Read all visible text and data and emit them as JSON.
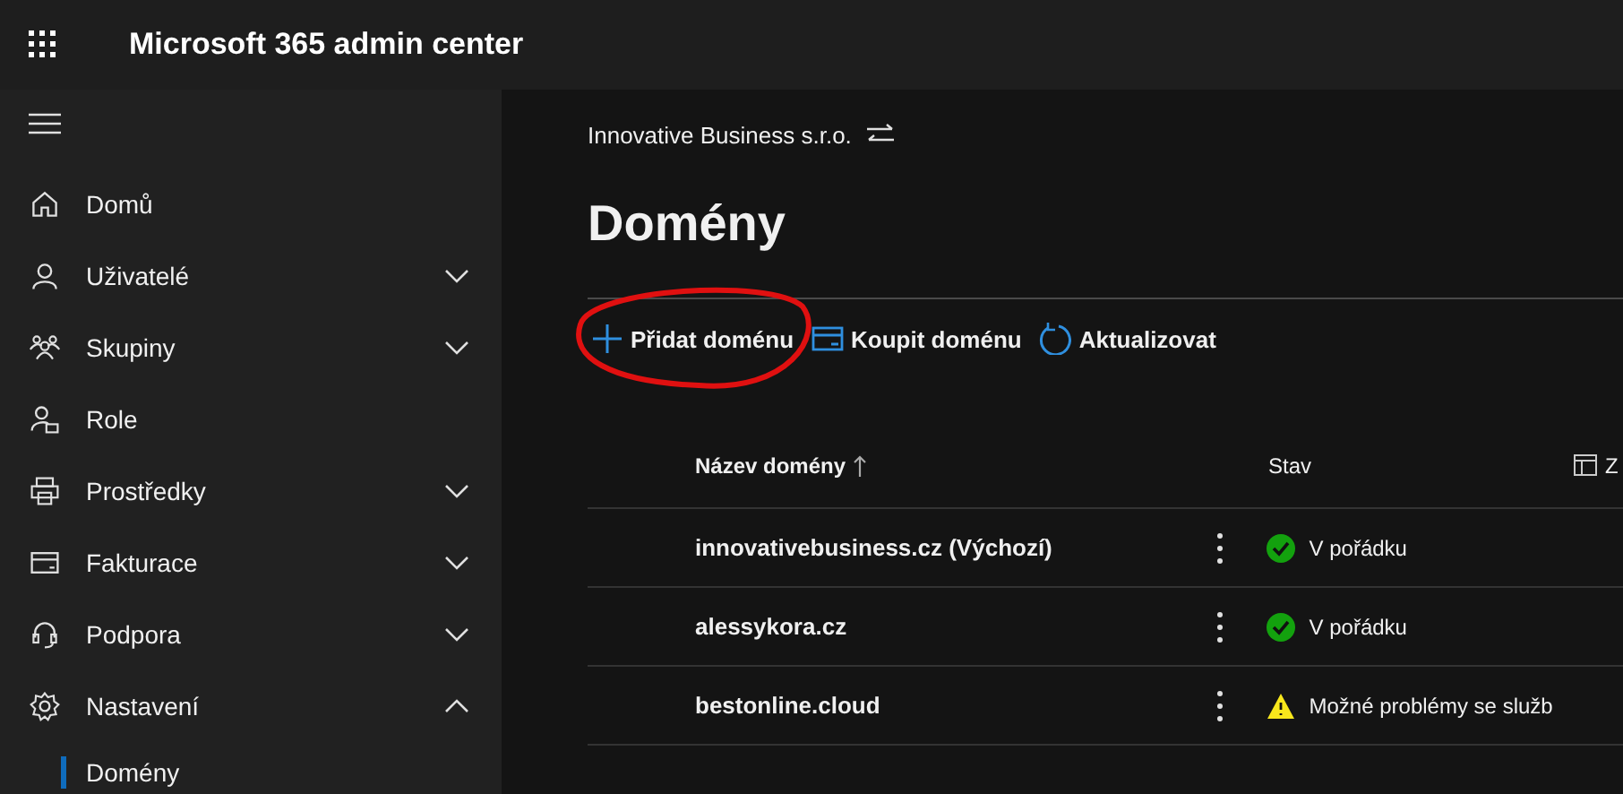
{
  "app": {
    "title": "Microsoft 365 admin center"
  },
  "sidebar": {
    "items": [
      {
        "label": "Domů"
      },
      {
        "label": "Uživatelé",
        "expanded": false
      },
      {
        "label": "Skupiny",
        "expanded": false
      },
      {
        "label": "Role"
      },
      {
        "label": "Prostředky",
        "expanded": false
      },
      {
        "label": "Fakturace",
        "expanded": false
      },
      {
        "label": "Podpora",
        "expanded": false
      },
      {
        "label": "Nastavení",
        "expanded": true,
        "children": [
          {
            "label": "Domény",
            "selected": true
          }
        ]
      }
    ]
  },
  "page": {
    "organization": "Innovative Business s.r.o.",
    "title": "Domény"
  },
  "toolbar": [
    {
      "label": "Přidat doménu",
      "circled": true
    },
    {
      "label": "Koupit doménu",
      "circled": false
    },
    {
      "label": "Aktualizovat",
      "circled": false
    }
  ],
  "table": {
    "columns": [
      {
        "label": "Název domény",
        "sorted": true
      },
      {
        "label": "Stav",
        "sorted": false
      },
      {
        "label": "Z",
        "sorted": false
      }
    ],
    "rows": [
      {
        "name": "innovativebusiness.cz (Výchozí)",
        "kind": "ok",
        "status": "V pořádku"
      },
      {
        "name": "alessykora.cz",
        "kind": "ok",
        "status": "V pořádku"
      },
      {
        "name": "bestonline.cloud",
        "kind": "warning",
        "status": "Možné problémy se služb"
      }
    ]
  }
}
